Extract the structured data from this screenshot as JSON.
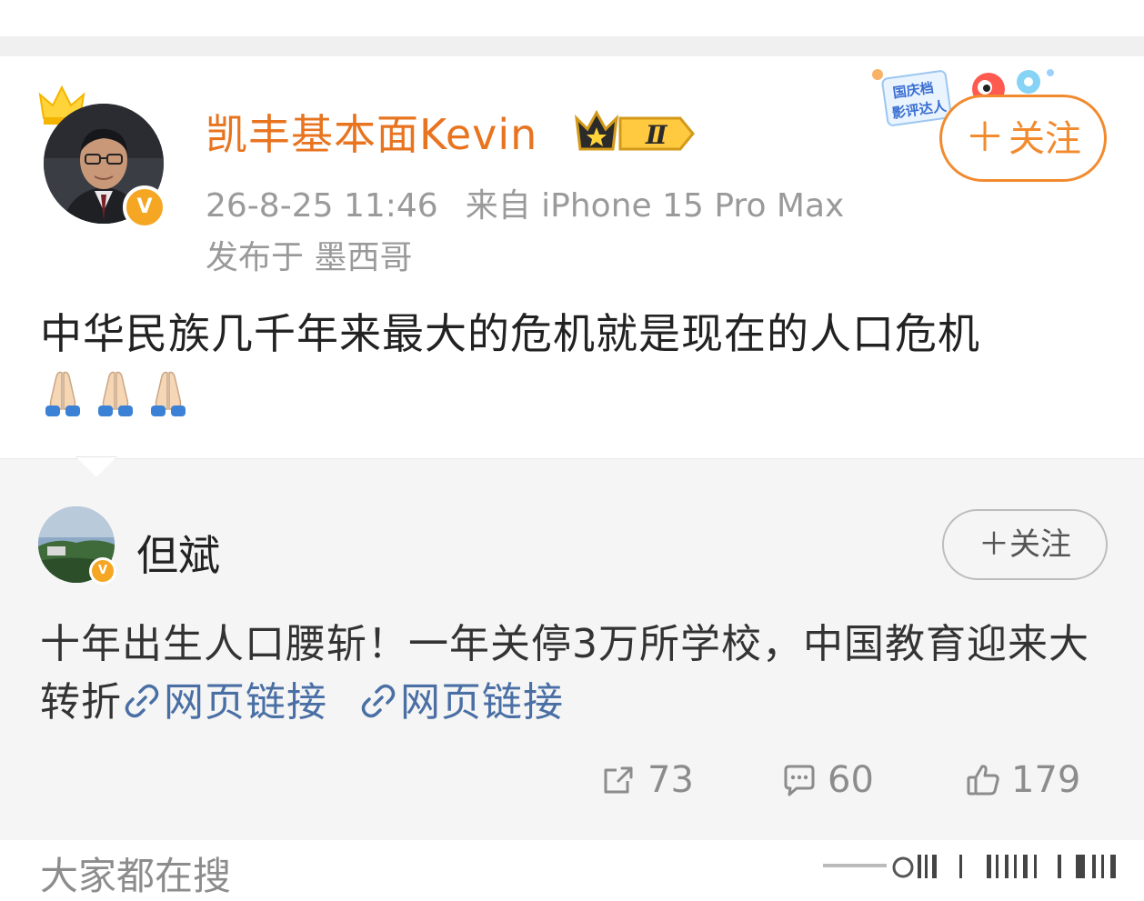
{
  "post": {
    "author": {
      "name": "凯丰基本面Kevin",
      "verified_badge": "v-badge",
      "level_badge": "Ⅱ"
    },
    "timestamp": "26-8-25 11:46",
    "source": "来自 iPhone 15 Pro Max",
    "location": "发布于 墨西哥",
    "follow_button": "关注",
    "promo_badge": "国庆档 影评达人",
    "text": "中华民族几千年来最大的危机就是现在的人口危机",
    "emoji": [
      "pray-emoji",
      "pray-emoji",
      "pray-emoji"
    ]
  },
  "repost": {
    "author": {
      "name": "但斌"
    },
    "follow_button": "关注",
    "text": "十年出生人口腰斩！一年关停3万所学校，中国教育迎来大转折",
    "links": [
      "网页链接",
      "网页链接"
    ],
    "actions": {
      "repost_count": "73",
      "comment_count": "60",
      "like_count": "179"
    }
  },
  "footer": {
    "hot_search_label": "大家都在搜"
  },
  "colors": {
    "author_name": "#e87420",
    "follow_border": "#f28a2e",
    "link": "#4a6fa5",
    "meta_gray": "#9a9a9a",
    "repost_bg": "#f5f5f5"
  }
}
